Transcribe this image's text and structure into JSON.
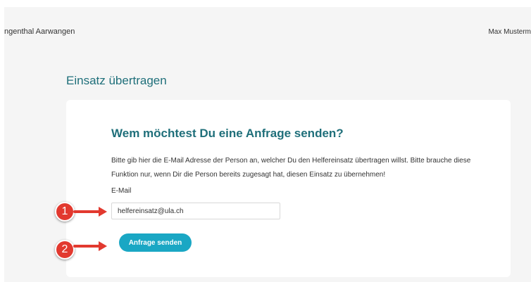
{
  "header": {
    "org_name": "ngenthal Aarwangen",
    "user_name": "Max Musterm"
  },
  "page": {
    "title": "Einsatz übertragen"
  },
  "card": {
    "title": "Wem möchtest Du eine Anfrage senden?",
    "description": "Bitte gib hier die E-Mail Adresse der Person an, welcher Du den Helfereinsatz übertragen willst. Bitte brauche diese Funktion nur, wenn Dir die Person bereits zugesagt hat, diesen Einsatz zu übernehmen!",
    "email_label": "E-Mail",
    "email_value": "helfereinsatz@ula.ch",
    "send_label": "Anfrage senden"
  },
  "annotations": {
    "marker_1": "1",
    "marker_2": "2"
  },
  "colors": {
    "accent": "#1aa7c4",
    "title": "#1f6f7a",
    "marker": "#e2392f",
    "background": "#f5f5f5"
  }
}
